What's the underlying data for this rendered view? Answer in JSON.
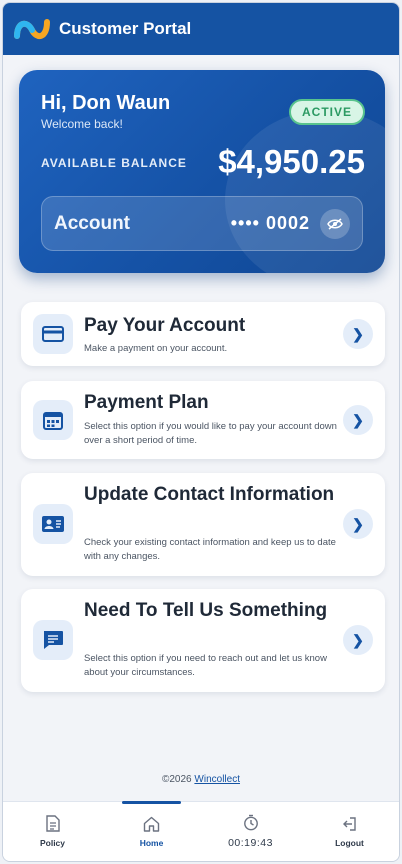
{
  "header": {
    "title": "Customer Portal"
  },
  "balance_card": {
    "greeting": "Hi, Don Waun",
    "welcome": "Welcome back!",
    "status": "ACTIVE",
    "balance_label": "AVAILABLE BALANCE",
    "balance": "$4,950.25",
    "account_label": "Account",
    "account_number": "•••• 0002"
  },
  "menu": [
    {
      "title": "Pay Your Account",
      "description": "Make a payment on your account.",
      "icon": "credit-card-icon"
    },
    {
      "title": "Payment Plan",
      "description": "Select this option if you would like to pay your account down over a short period of time.",
      "icon": "calendar-icon"
    },
    {
      "title": "Update Contact Information",
      "description": "Check your existing contact information and keep us to date with any changes.",
      "icon": "contact-card-icon"
    },
    {
      "title": "Need To Tell Us Something",
      "description": "Select this option if you need to reach out and let us know about your circumstances.",
      "icon": "message-icon"
    }
  ],
  "footer": {
    "copyright": "©2026",
    "link": "Wincollect"
  },
  "nav": {
    "policy": "Policy",
    "home": "Home",
    "timer": "00:19:43",
    "logout": "Logout",
    "active": "Home"
  },
  "colors": {
    "primary": "#1553a3",
    "active_badge": "#2c9a63",
    "background": "#f2f4f8"
  }
}
